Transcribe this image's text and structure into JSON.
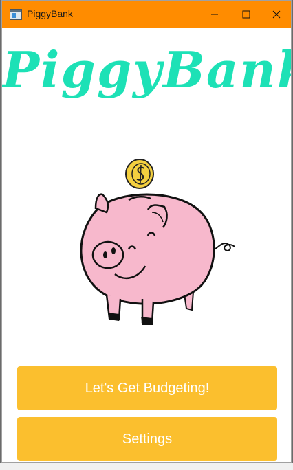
{
  "window": {
    "title": "PiggyBank",
    "controls": [
      "minimize-icon",
      "maximize-icon",
      "close-icon"
    ]
  },
  "brand": {
    "text": "PiggyBank",
    "color": "#1de1b6"
  },
  "illustration": {
    "icon": "piggy-bank-with-coin"
  },
  "actions": {
    "budget_label": "Let's Get Budgeting!",
    "settings_label": "Settings"
  },
  "colors": {
    "titlebar": "#ff8c00",
    "button": "#fbbf2e",
    "button_text": "#ffffff"
  }
}
